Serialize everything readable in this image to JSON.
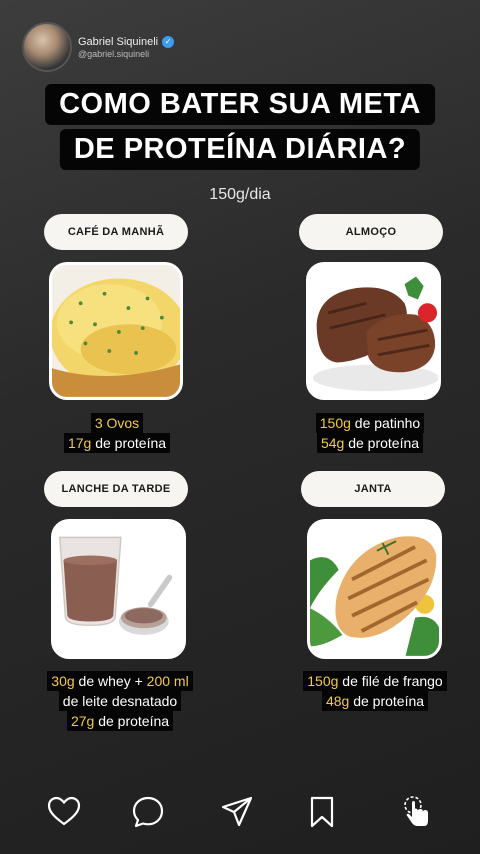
{
  "profile": {
    "name": "Gabriel Siquineli",
    "handle": "@gabriel.siquineli"
  },
  "title": {
    "line1": "COMO BATER SUA META",
    "line2": "DE PROTEÍNA DIÁRIA?"
  },
  "subtitle": "150g/dia",
  "meals": {
    "breakfast": {
      "label": "CAFÉ DA MANHÃ",
      "image": "scrambled-eggs",
      "line1_hl": "3 Ovos",
      "line2_hl": "17g",
      "line2_rest": " de proteína"
    },
    "lunch": {
      "label": "ALMOÇO",
      "image": "grilled-steak",
      "line1_hl": "150g",
      "line1_rest": " de patinho",
      "line2_hl": "54g",
      "line2_rest": " de proteína"
    },
    "snack": {
      "label": "LANCHE DA TARDE",
      "image": "protein-shake",
      "line1_hl_a": "30g",
      "line1_mid": " de whey + ",
      "line1_hl_b": "200 ml",
      "line2": "de leite desnatado",
      "line3_hl": "27g",
      "line3_rest": " de proteína"
    },
    "dinner": {
      "label": "JANTA",
      "image": "grilled-chicken",
      "line1_hl": "150g",
      "line1_rest": " de filé de frango",
      "line2_hl": "48g",
      "line2_rest": " de proteína"
    }
  },
  "bottom_icons": [
    "heart-icon",
    "comment-icon",
    "share-icon",
    "bookmark-icon",
    "tap-icon"
  ],
  "colors": {
    "highlight": "#f2c94c",
    "pill": "#f7f5f1",
    "label_bg": "#050505",
    "verified": "#3b9cf0"
  }
}
